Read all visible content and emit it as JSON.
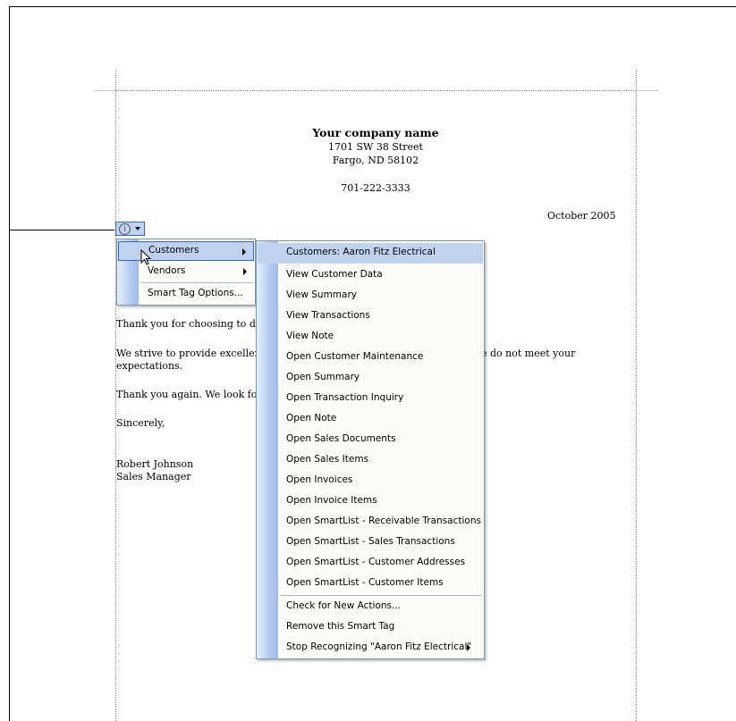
{
  "document": {
    "company_name": "Your company name",
    "address_line1": "1701 SW 38 Street",
    "address_line2": "Fargo, ND 58102",
    "phone": "701-222-3333",
    "date": "October 2005",
    "paragraphs": [
      "Thank you for choosing to do",
      "We strive to provide exceller",
      "e do not meet your",
      "expectations.",
      "Thank you again. We look fo",
      "Sincerely,",
      "Robert Johnson",
      "Sales Manager"
    ]
  },
  "smart_tag": {
    "icon": "info-circle-icon",
    "icon_glyph": "i"
  },
  "context_menu": {
    "items": [
      {
        "label": "Customers",
        "has_submenu": true,
        "highlighted": true
      },
      {
        "label": "Vendors",
        "has_submenu": true,
        "highlighted": false
      },
      {
        "label": "Smart Tag Options...",
        "has_submenu": false,
        "highlighted": false
      }
    ]
  },
  "actions_menu": {
    "items": [
      {
        "label": "Customers: Aaron Fitz Electrical",
        "highlighted": true
      },
      {
        "label": "View Customer Data"
      },
      {
        "label": "View Summary"
      },
      {
        "label": "View Transactions"
      },
      {
        "label": "View Note"
      },
      {
        "label": "Open Customer Maintenance"
      },
      {
        "label": "Open Summary"
      },
      {
        "label": "Open Transaction Inquiry"
      },
      {
        "label": "Open Note"
      },
      {
        "label": "Open Sales Documents"
      },
      {
        "label": "Open Sales Items"
      },
      {
        "label": "Open Invoices"
      },
      {
        "label": "Open Invoice Items"
      },
      {
        "label": "Open SmartList - Receivable Transactions"
      },
      {
        "label": "Open SmartList - Sales Transactions"
      },
      {
        "label": "Open SmartList - Customer Addresses"
      },
      {
        "label": "Open SmartList - Customer Items"
      }
    ],
    "footer_items": [
      {
        "label": "Check for New Actions..."
      },
      {
        "label": "Remove this Smart Tag"
      },
      {
        "label": "Stop Recognizing \"Aaron Fitz Electrical\"",
        "has_submenu": true
      }
    ]
  }
}
